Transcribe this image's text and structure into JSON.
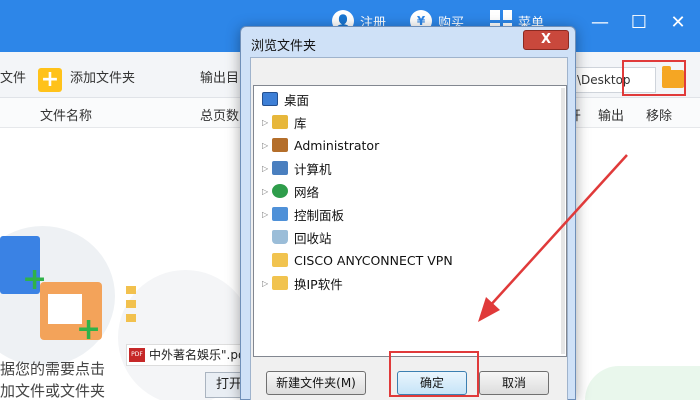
{
  "titlebar": {
    "register_label": "注册",
    "buy_label": "购买",
    "menu_label": "菜单",
    "buy_icon": "¥",
    "minimize": "—",
    "maximize": "☐",
    "close": "✕"
  },
  "toolbar": {
    "file_label": "文件",
    "add_folder_label": "添加文件夹",
    "output_dir_label": "输出目",
    "path_value": "\\Desktop"
  },
  "columns": {
    "file_name": "文件名称",
    "total_pages": "总页数",
    "open": "开",
    "output": "输出",
    "remove": "移除"
  },
  "empty_hint": {
    "line1": "据您的需要点击",
    "line2": "加文件或文件夹"
  },
  "background_preview": {
    "pdf_badge": "PDF",
    "pdf_name": "中外著名娛乐\".pdf",
    "open_button": "打开"
  },
  "dialog": {
    "title": "浏览文件夹",
    "close_label": "X",
    "tree": [
      {
        "label": "桌面",
        "icon": "desktop-icon",
        "expandable": false,
        "selected": true
      },
      {
        "label": "库",
        "icon": "library-icon",
        "expandable": true
      },
      {
        "label": "Administrator",
        "icon": "user-folder-icon",
        "expandable": true
      },
      {
        "label": "计算机",
        "icon": "computer-icon",
        "expandable": true
      },
      {
        "label": "网络",
        "icon": "network-icon",
        "expandable": true
      },
      {
        "label": "控制面板",
        "icon": "control-panel-icon",
        "expandable": true
      },
      {
        "label": "回收站",
        "icon": "recycle-bin-icon",
        "expandable": false
      },
      {
        "label": "CISCO ANYCONNECT VPN",
        "icon": "folder-icon",
        "expandable": false
      },
      {
        "label": "换IP软件",
        "icon": "folder-icon",
        "expandable": true
      }
    ],
    "new_folder_label": "新建文件夹(M)",
    "ok_label": "确定",
    "cancel_label": "取消"
  },
  "colors": {
    "accent_blue": "#2d86e8",
    "highlight_red": "#e03a3a",
    "dialog_frame": "#cfe1f7"
  }
}
